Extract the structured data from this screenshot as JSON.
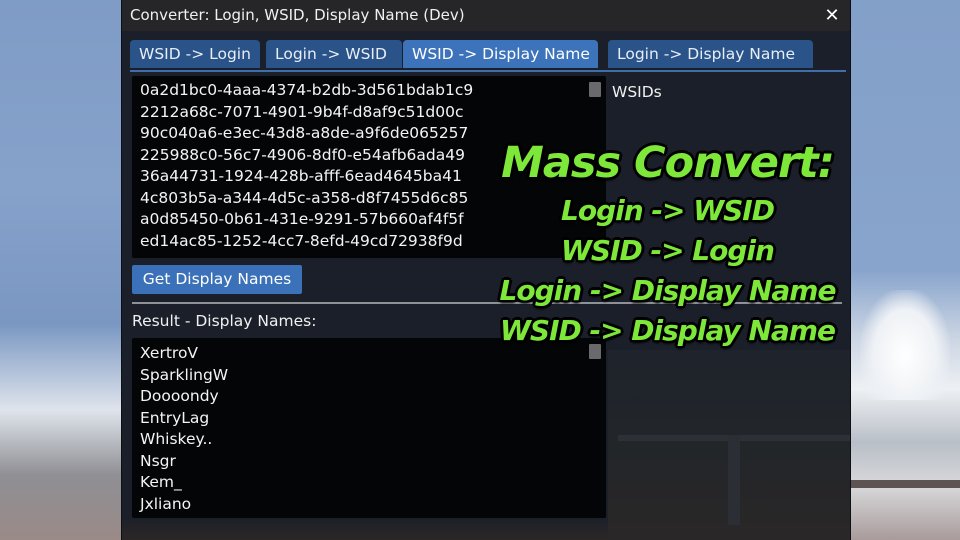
{
  "window": {
    "title": "Converter: Login, WSID, Display Name (Dev)",
    "close_glyph": "✕"
  },
  "tabs": [
    {
      "label": "WSID -> Login",
      "active": false
    },
    {
      "label": "Login -> WSID",
      "active": false
    },
    {
      "label": "WSID -> Display Name",
      "active": true
    },
    {
      "label": "Login -> Display Name",
      "active": false
    }
  ],
  "input": {
    "label": "WSIDs",
    "lines": "0a2d1bc0-4aaa-4374-b2db-3d561bdab1c9\n2212a68c-7071-4901-9b4f-d8af9c51d00c\n90c040a6-e3ec-43d8-a8de-a9f6de065257\n225988c0-56c7-4906-8df0-e54afb6ada49\n36a44731-1924-428b-afff-6ead4645ba41\n4c803b5a-a344-4d5c-a358-d8f7455d6c85\na0d85450-0b61-431e-9291-57b660af4f5f\ned14ac85-1252-4cc7-8efd-49cd72938f9d"
  },
  "action": {
    "button_label": "Get Display Names"
  },
  "result": {
    "label": "Result - Display Names:",
    "lines": "XertroV\nSparklingW\nDoooondy\nEntryLag\nWhiskey..\nNsgr\nKem_\nJxliano"
  },
  "overlay": {
    "headline": "Mass Convert:",
    "lines": [
      "Login -> WSID",
      "WSID -> Login",
      "Login -> Display Name",
      "WSID -> Display Name"
    ],
    "color": "#7ee83a"
  },
  "colors": {
    "tab_active": "#3d73ba",
    "tab_inactive": "#2a5389",
    "button": "#3a71b8"
  }
}
